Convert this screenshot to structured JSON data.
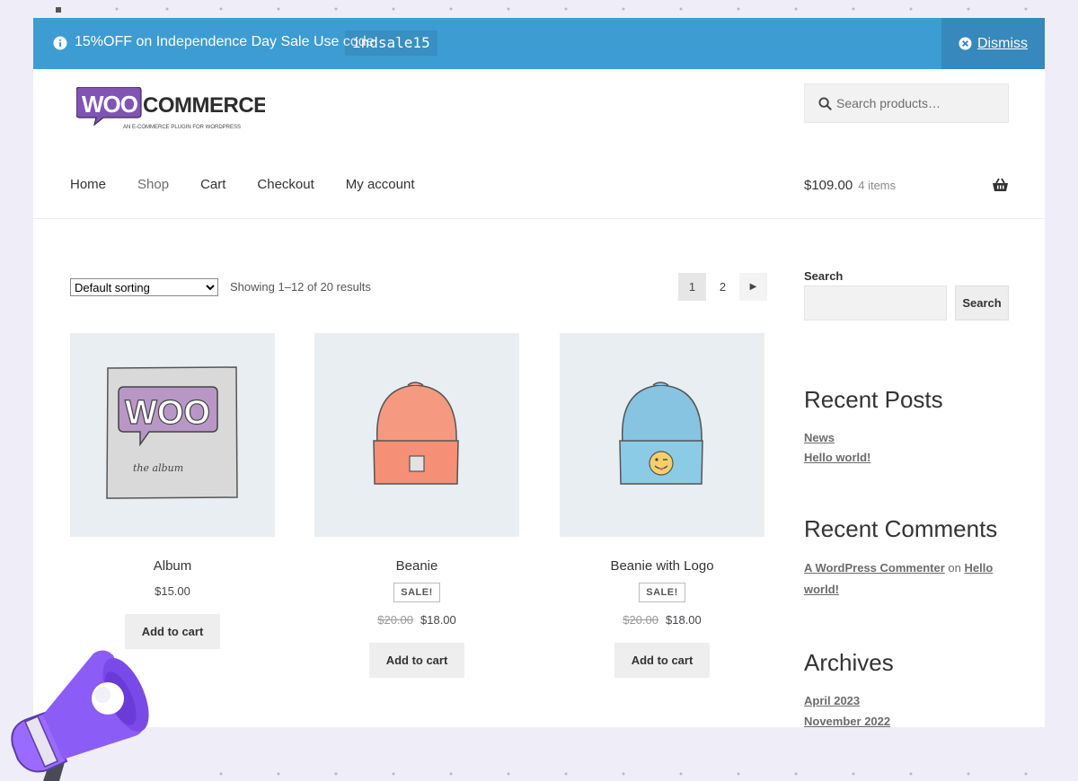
{
  "notice": {
    "text": "15%OFF on Independence Day Sale Use code:",
    "code": "indsale15",
    "dismiss_label": "Dismiss"
  },
  "header": {
    "logo_text": "WOOCOMMERCE",
    "logo_tagline": "AN E-COMMERCE PLUGIN FOR WORDPRESS",
    "search_placeholder": "Search products…"
  },
  "nav": {
    "items": [
      "Home",
      "Shop",
      "Cart",
      "Checkout",
      "My account"
    ],
    "active": "Shop"
  },
  "cart": {
    "total": "$109.00",
    "count": "4 items"
  },
  "toolbar": {
    "sorting_selected": "Default sorting",
    "result_count": "Showing 1–12 of 20 results",
    "pages": [
      "1",
      "2"
    ],
    "current_page": "1"
  },
  "products": [
    {
      "name": "Album",
      "price": "$15.00",
      "sale": false,
      "button": "Add to cart"
    },
    {
      "name": "Beanie",
      "badge": "SALE!",
      "old_price": "$20.00",
      "price": "$18.00",
      "sale": true,
      "button": "Add to cart"
    },
    {
      "name": "Beanie with Logo",
      "badge": "SALE!",
      "old_price": "$20.00",
      "price": "$18.00",
      "sale": true,
      "button": "Add to cart"
    }
  ],
  "album_art": {
    "word": "WOO",
    "caption": "the album"
  },
  "sidebar": {
    "search_label": "Search",
    "search_button": "Search",
    "recent_posts_title": "Recent Posts",
    "recent_posts": [
      "News",
      "Hello world!"
    ],
    "recent_comments_title": "Recent Comments",
    "comment_author": "A WordPress Commenter",
    "comment_on": "on",
    "comment_post_line1": "Hello",
    "comment_post_line2": "world!",
    "archives_title": "Archives",
    "archives": [
      "April 2023",
      "November 2022"
    ]
  },
  "colors": {
    "notice_bg": "#3d9cd2",
    "dismiss_bg": "#3788bd",
    "woo_purple": "#7f54b3",
    "page_bg": "#efedf8",
    "megaphone": "#8b5cf6"
  }
}
